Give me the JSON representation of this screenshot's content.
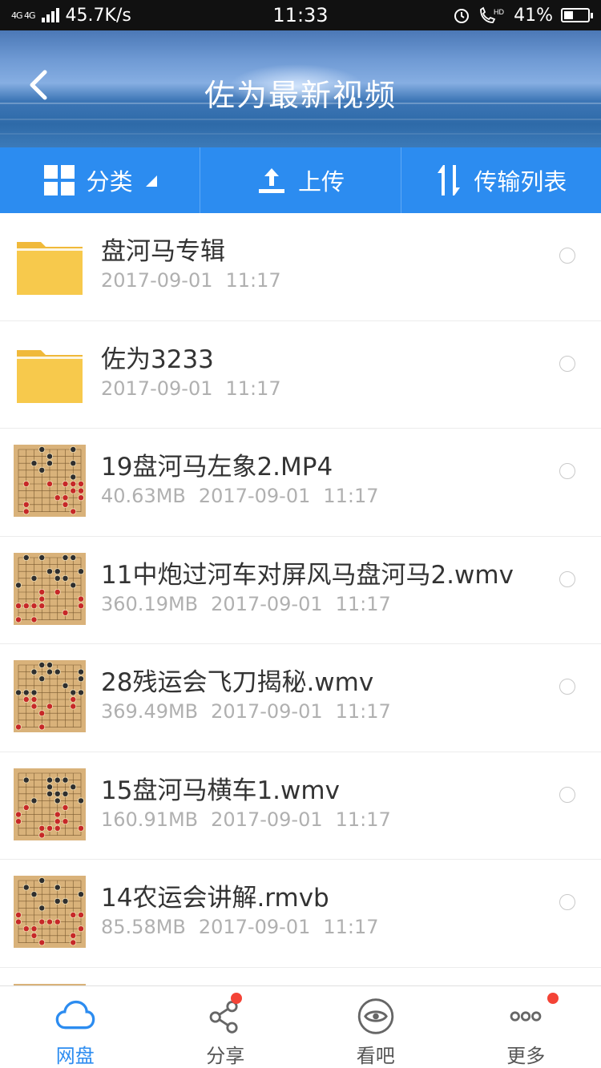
{
  "status_bar": {
    "network": "4G 4G",
    "speed": "45.7K/s",
    "time": "11:33",
    "battery": "41%",
    "battery_level": 0.41
  },
  "header": {
    "title": "佐为最新视频"
  },
  "toolbar": {
    "category": "分类",
    "upload": "上传",
    "transfer": "传输列表"
  },
  "files": [
    {
      "name": "盘河马专辑",
      "size": "",
      "date": "2017-09-01",
      "time": "11:17",
      "type": "folder"
    },
    {
      "name": "佐为3233",
      "size": "",
      "date": "2017-09-01",
      "time": "11:17",
      "type": "folder"
    },
    {
      "name": "19盘河马左象2.MP4",
      "size": "40.63MB",
      "date": "2017-09-01",
      "time": "11:17",
      "type": "video"
    },
    {
      "name": "11中炮过河车对屏风马盘河马2.wmv",
      "size": "360.19MB",
      "date": "2017-09-01",
      "time": "11:17",
      "type": "video"
    },
    {
      "name": "28残运会飞刀揭秘.wmv",
      "size": "369.49MB",
      "date": "2017-09-01",
      "time": "11:17",
      "type": "video"
    },
    {
      "name": "15盘河马横车1.wmv",
      "size": "160.91MB",
      "date": "2017-09-01",
      "time": "11:17",
      "type": "video"
    },
    {
      "name": "14农运会讲解.rmvb",
      "size": "85.58MB",
      "date": "2017-09-01",
      "time": "11:17",
      "type": "video"
    }
  ],
  "bottom_nav": {
    "disk": "网盘",
    "share": "分享",
    "watch": "看吧",
    "more": "更多"
  },
  "colors": {
    "accent": "#2c8cf0",
    "folder": "#f5c445",
    "badge": "#f44336"
  }
}
